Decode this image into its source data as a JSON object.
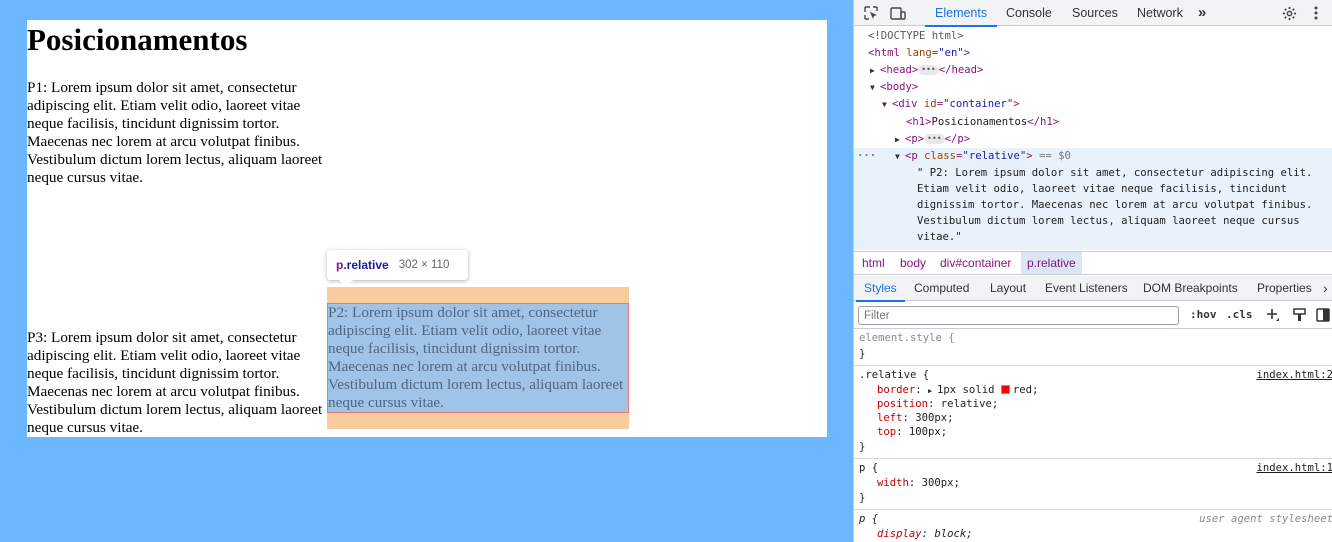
{
  "page": {
    "heading": "Posicionamentos",
    "p1": "P1: Lorem ipsum dolor sit amet, consectetur adipiscing elit. Etiam velit odio, laoreet vitae neque facilisis, tincidunt dignissim tortor. Maecenas nec lorem at arcu volutpat finibus. Vestibulum dictum lorem lectus, aliquam laoreet neque cursus vitae.",
    "p2": "P2: Lorem ipsum dolor sit amet, consectetur adipiscing elit. Etiam velit odio, laoreet vitae neque facilisis, tincidunt dignissim tortor. Maecenas nec lorem at arcu volutpat finibus. Vestibulum dictum lorem lectus, aliquam laoreet neque cursus vitae.",
    "p3": "P3: Lorem ipsum dolor sit amet, consectetur adipiscing elit. Etiam velit odio, laoreet vitae neque facilisis, tincidunt dignissim tortor. Maecenas nec lorem at arcu volutpat finibus. Vestibulum dictum lorem lectus, aliquam laoreet neque cursus vitae."
  },
  "tooltip": {
    "tag": "p",
    "cls": ".relative",
    "size": "302 × 110"
  },
  "devtools": {
    "tabs": [
      "Elements",
      "Console",
      "Sources",
      "Network"
    ],
    "active_tab": "Elements",
    "more_tabs": "»",
    "icons": [
      "inspect-icon",
      "device-toggle-icon",
      "more-tabs-icon",
      "settings-icon",
      "kebab-menu-icon"
    ],
    "tree": {
      "doctype": "<!DOCTYPE html>",
      "html_open": "html",
      "html_attr": "lang",
      "html_val": "\"en\"",
      "head": "head",
      "body": "body",
      "div_tag": "div",
      "div_attr": "id",
      "div_val": "\"container\"",
      "h1_tag": "h1",
      "h1_text": "Posicionamentos",
      "p_tag": "p",
      "p_attr": "class",
      "p_val": "\"relative\"",
      "dollar": "== $0",
      "p_text_1": "\" P2: Lorem ipsum dolor sit amet, consectetur adipiscing elit.",
      "p_text_2": "Etiam velit odio, laoreet vitae neque facilisis, tincidunt",
      "p_text_3": "dignissim tortor. Maecenas nec lorem at arcu volutpat finibus.",
      "p_text_4": "Vestibulum dictum lorem lectus, aliquam laoreet neque cursus",
      "p_text_5": "vitae.\"",
      "gutter_dots": "···"
    },
    "breadcrumbs": [
      "html",
      "body",
      "div#container",
      "p.relative"
    ],
    "subtabs": [
      "Styles",
      "Computed",
      "Layout",
      "Event Listeners",
      "DOM Breakpoints",
      "Properties"
    ],
    "active_subtab": "Styles",
    "filter_placeholder": "Filter",
    "hov": ":hov",
    "cls": ".cls",
    "styles": {
      "element_style": "element.style {",
      "close": "}",
      "relative_sel": ".relative {",
      "relative_src": "index.html:2",
      "border_prop": "border",
      "border_val": "1px solid",
      "border_color": "red;",
      "position_prop": "position",
      "position_val": "relative;",
      "left_prop": "left",
      "left_val": "300px;",
      "top_prop": "top",
      "top_val": "100px;",
      "p_sel": "p {",
      "p_src": "index.html:1",
      "width_prop": "width",
      "width_val": "300px;",
      "ua_sel": "p {",
      "ua_src": "user agent stylesheet",
      "display_prop": "display",
      "display_val": "block;"
    }
  },
  "colors": {
    "page_background": "#6cb8ff",
    "accent": "#1a73e8",
    "margin_highlight": "#f9cc9d",
    "content_highlight": "#a0c4e8",
    "swatch_red": "#ff0000"
  }
}
